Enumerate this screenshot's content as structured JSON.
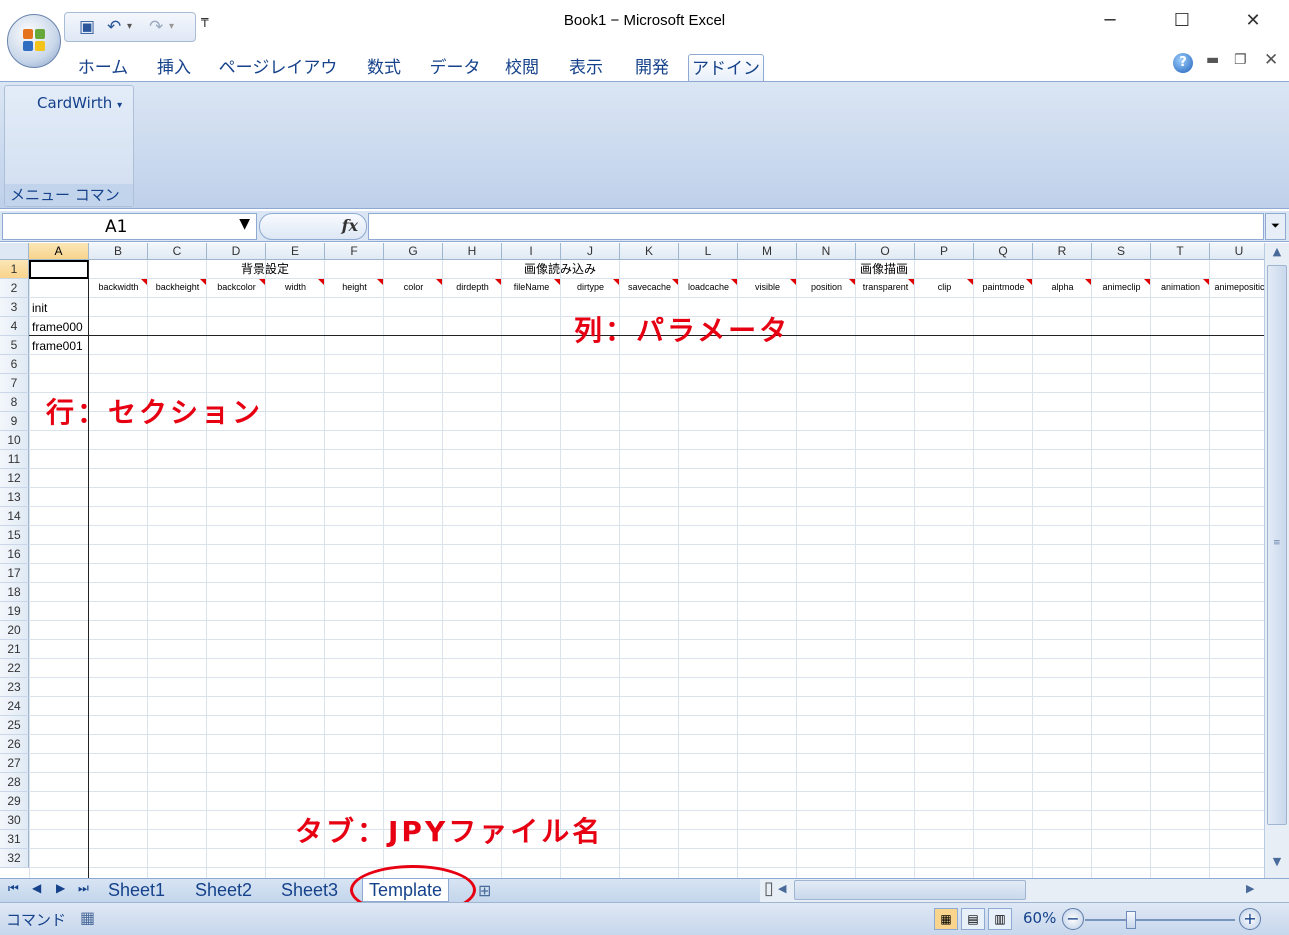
{
  "window": {
    "title": "Book1 − Microsoft Excel",
    "minimize": "─",
    "maximize": "☐",
    "close": "✕"
  },
  "qat": {
    "save_icon": "save-icon",
    "undo_icon": "undo-icon",
    "redo_icon": "redo-icon",
    "customize_icon": "chevron-down-icon"
  },
  "menu": {
    "tabs": [
      "ホーム",
      "挿入",
      "ページレイアウト",
      "数式",
      "データ",
      "校閲",
      "表示",
      "開発",
      "アドイン"
    ],
    "active_index": 8,
    "help_icon": "help-icon"
  },
  "ribbon": {
    "cardwirth_label": "CardWirth",
    "group_label": "メニュー コマンド"
  },
  "formula_bar": {
    "name_box": "A1",
    "fx": "fx",
    "value": ""
  },
  "grid": {
    "columns": [
      "A",
      "B",
      "C",
      "D",
      "E",
      "F",
      "G",
      "H",
      "I",
      "J",
      "K",
      "L",
      "M",
      "N",
      "O",
      "P",
      "Q",
      "R",
      "S",
      "T",
      "U"
    ],
    "rows": [
      "1",
      "2",
      "3",
      "4",
      "5",
      "6",
      "7",
      "8",
      "9",
      "10",
      "11",
      "12",
      "13",
      "14",
      "15",
      "16",
      "17",
      "18",
      "19",
      "20",
      "21",
      "22",
      "23",
      "24",
      "25",
      "26",
      "27",
      "28",
      "29",
      "30",
      "31",
      "32"
    ],
    "selected_cell": "A1",
    "row1_groups": [
      "背景設定",
      "画像読み込み",
      "画像描画"
    ],
    "row2_params": [
      "backwidth",
      "backheight",
      "backcolor",
      "width",
      "height",
      "color",
      "dirdepth",
      "fileName",
      "dirtype",
      "savecache",
      "loadcache",
      "visible",
      "position",
      "transparent",
      "clip",
      "paintmode",
      "alpha",
      "animeclip",
      "animation",
      "animepositic"
    ],
    "col_a": {
      "r3": "init",
      "r4": "frame000",
      "r5": "frame001"
    }
  },
  "annotations": {
    "columns": "列：パラメータ",
    "rows": "行：セクション",
    "tab": "タブ：JPYファイル名"
  },
  "colors": {
    "annotation": "#e60012",
    "comment_marker": "#e00000",
    "accent": "#15428b"
  },
  "sheets": {
    "tabs": [
      "Sheet1",
      "Sheet2",
      "Sheet3",
      "Template"
    ],
    "active": "Template"
  },
  "status": {
    "mode": "コマンド",
    "zoom": "60%"
  }
}
